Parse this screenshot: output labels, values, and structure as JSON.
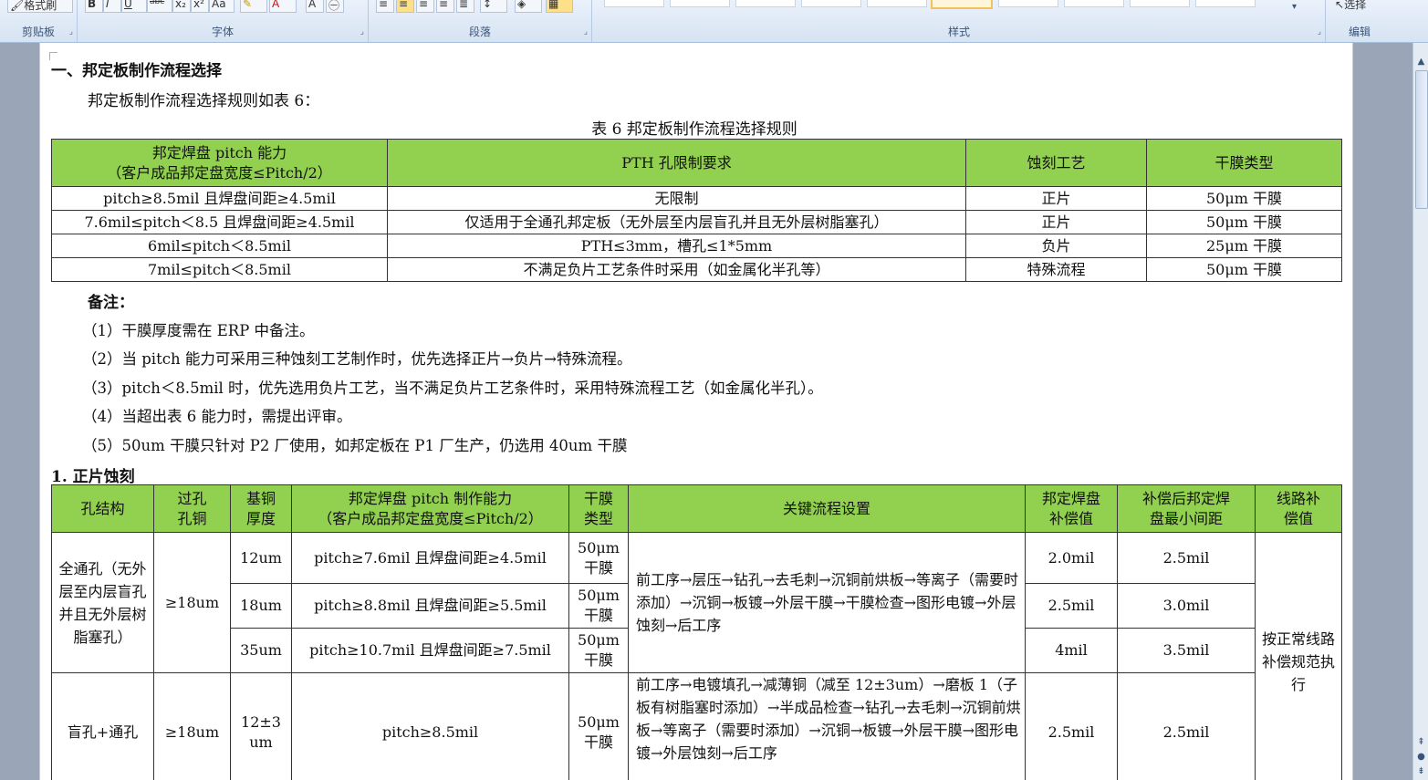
{
  "ribbon": {
    "clipboard_label": "剪贴板",
    "font_label": "字体",
    "paragraph_label": "段落",
    "styles_label": "样式",
    "editing_label": "编辑",
    "format_painter_label": "格式刷",
    "select_label": "选择"
  },
  "doc": {
    "section_title": "一、邦定板制作流程选择",
    "intro": "邦定板制作流程选择规则如表 6：",
    "table_caption": "表 6  邦定板制作流程选择规则",
    "table6": {
      "headers": [
        "邦定焊盘 pitch 能力（客户成品邦定盘宽度≤Pitch/2）",
        "PTH 孔限制要求",
        "蚀刻工艺",
        "干膜类型"
      ],
      "header_line1": "邦定焊盘 pitch 能力",
      "header_line2": "（客户成品邦定盘宽度≤Pitch/2）",
      "rows": [
        [
          "pitch≥8.5mil 且焊盘间距≥4.5mil",
          "无限制",
          "正片",
          "50μm 干膜"
        ],
        [
          "7.6mil≤pitch＜8.5 且焊盘间距≥4.5mil",
          "仅适用于全通孔邦定板（无外层至内层盲孔并且无外层树脂塞孔）",
          "正片",
          "50μm 干膜"
        ],
        [
          "6mil≤pitch＜8.5mil",
          "PTH≤3mm，槽孔≤1*5mm",
          "负片",
          "25μm 干膜"
        ],
        [
          "7mil≤pitch＜8.5mil",
          "不满足负片工艺条件时采用（如金属化半孔等）",
          "特殊流程",
          "50μm 干膜"
        ]
      ]
    },
    "notes_title": "备注：",
    "notes": [
      "（1）干膜厚度需在 ERP 中备注。",
      "（2）当 pitch 能力可采用三种蚀刻工艺制作时，优先选择正片→负片→特殊流程。",
      "（3）pitch＜8.5mil 时，优先选用负片工艺，当不满足负片工艺条件时，采用特殊流程工艺（如金属化半孔）。",
      "（4）当超出表 6 能力时，需提出评审。",
      "（5）50um 干膜只针对 P2 厂使用，如邦定板在 P1 厂生产，仍选用 40um 干膜"
    ],
    "section2_title": "1.  正片蚀刻",
    "table2": {
      "headers": {
        "hole_structure": "孔结构",
        "via_copper_1": "过孔",
        "via_copper_2": "孔铜",
        "base_copper_1": "基铜",
        "base_copper_2": "厚度",
        "pitch_1": "邦定焊盘 pitch 制作能力",
        "pitch_2": "（客户成品邦定盘宽度≤Pitch/2）",
        "film_1": "干膜",
        "film_2": "类型",
        "flow": "关键流程设置",
        "comp_1": "邦定焊盘",
        "comp_2": "补偿值",
        "min_1": "补偿后邦定焊",
        "min_2": "盘最小间距",
        "line_1": "线路补",
        "line_2": "偿值"
      },
      "group1_structure": "全通孔（无外层至内层盲孔并且无外层树脂塞孔）",
      "group1_via": "≥18um",
      "group1_flow": "前工序→层压→钻孔→去毛刺→沉铜前烘板→等离子（需要时添加）→沉铜→板镀→外层干膜→干膜检查→图形电镀→外层蚀刻→后工序",
      "group1_rows": [
        {
          "base": "12um",
          "pitch": "pitch≥7.6mil 且焊盘间距≥4.5mil",
          "film": "50μm 干膜",
          "comp": "2.0mil",
          "min": "2.5mil"
        },
        {
          "base": "18um",
          "pitch": "pitch≥8.8mil 且焊盘间距≥5.5mil",
          "film": "50μm 干膜",
          "comp": "2.5mil",
          "min": "3.0mil"
        },
        {
          "base": "35um",
          "pitch": "pitch≥10.7mil 且焊盘间距≥7.5mil",
          "film": "50μm 干膜",
          "comp": "4mil",
          "min": "3.5mil"
        }
      ],
      "group2": {
        "structure": "盲孔+通孔",
        "via": "≥18um",
        "base": "12±3 um",
        "pitch": "pitch≥8.5mil",
        "film": "50μm 干膜",
        "flow": "前工序→电镀填孔→减薄铜（减至 12±3um）→磨板 1（子板有树脂塞时添加）→半成品检查→钻孔→去毛刺→沉铜前烘板→等离子（需要时添加）→沉铜→板镀→外层干膜→图形电镀→外层蚀刻→后工序",
        "comp": "2.5mil",
        "min": "2.5mil"
      },
      "line_comp_value": "按正常线路补偿规范执行"
    }
  },
  "colors": {
    "table_header_green": "#92d050",
    "ribbon_bg": "#dfe9f5",
    "workspace_bg": "#9aa6b7"
  }
}
